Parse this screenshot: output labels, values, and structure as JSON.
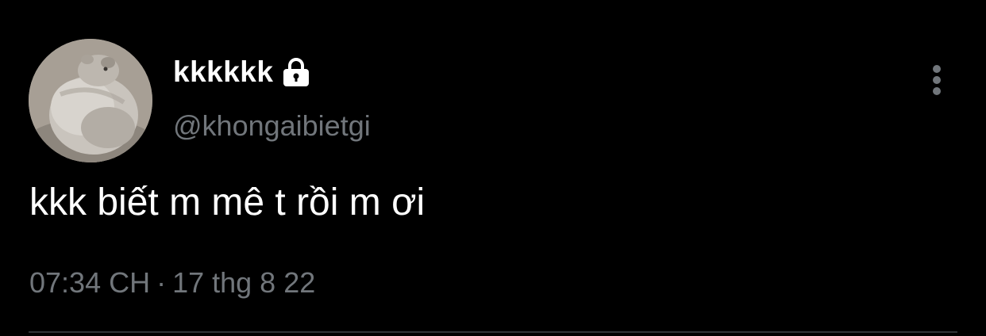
{
  "tweet": {
    "author": {
      "display_name": "kkkkkk",
      "handle": "@khongaibietgi",
      "protected_icon": "lock-icon",
      "avatar_icon": "hamster-avatar"
    },
    "text": "kkk biết m mê t rồi m ơi",
    "time": "07:34 CH",
    "separator": "·",
    "date": "17 thg 8 22",
    "more_icon": "more-vertical-icon"
  },
  "colors": {
    "background": "#000000",
    "primary_text": "#ffffff",
    "secondary_text": "#71767b",
    "divider": "#2f3336"
  }
}
